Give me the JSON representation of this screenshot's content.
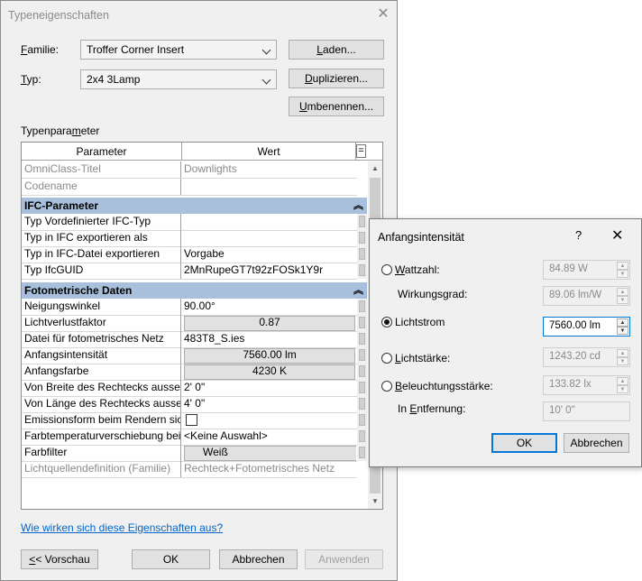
{
  "main_dialog": {
    "title": "Typeneigenschaften",
    "close": "✕",
    "familie_label": "Familie:",
    "familie_value": "Troffer Corner Insert",
    "typ_label": "Typ:",
    "typ_value": "2x4 3Lamp",
    "btn_laden": "Laden...",
    "btn_duplizieren": "Duplizieren...",
    "btn_umbenennen": "Umbenennen...",
    "typenparameter_label": "Typenparameter",
    "table_header": {
      "parameter": "Parameter",
      "wert": "Wert",
      "toggle": "="
    },
    "rows_top": [
      {
        "param": "OmniClass-Titel",
        "value": "Downlights"
      },
      {
        "param": "Codename",
        "value": ""
      }
    ],
    "group_ifc": "IFC-Parameter",
    "rows_ifc": [
      {
        "param": "Typ Vordefinierter IFC-Typ",
        "value": ""
      },
      {
        "param": "Typ in IFC exportieren als",
        "value": ""
      },
      {
        "param": "Typ in IFC-Datei exportieren",
        "value": "Vorgabe"
      },
      {
        "param": "Typ IfcGUID",
        "value": "2MnRupeGT7t92zFOSk1Y9r"
      }
    ],
    "group_foto": "Fotometrische Daten",
    "rows_foto": {
      "neigungswinkel": {
        "param": "Neigungswinkel",
        "value": "90.00°"
      },
      "lichtverlustfaktor": {
        "param": "Lichtverlustfaktor",
        "value": "0.87"
      },
      "datei": {
        "param": "Datei für fotometrisches Netz",
        "value": "483T8_S.ies"
      },
      "anfangsintensitaet": {
        "param": "Anfangsintensität",
        "value": "7560.00 lm"
      },
      "anfangsfarbe": {
        "param": "Anfangsfarbe",
        "value": "4230 K"
      },
      "breite": {
        "param": "Von Breite des Rechtecks ausse",
        "value": "2'  0\""
      },
      "laenge": {
        "param": "Von Länge des Rechtecks aussen",
        "value": "4'  0\""
      },
      "emission": {
        "param": "Emissionsform beim Rendern sic",
        "value": ""
      },
      "farbtemp": {
        "param": "Farbtemperaturverschiebung bei",
        "value": "<Keine Auswahl>"
      },
      "farbfilter": {
        "param": "Farbfilter",
        "value": "Weiß"
      },
      "lichtquelle": {
        "param": "Lichtquellendefinition (Familie)",
        "value": "Rechteck+Fotometrisches Netz"
      }
    },
    "help_link": "Wie wirken sich diese Eigenschaften aus?",
    "btn_vorschau": "<< Vorschau",
    "btn_ok": "OK",
    "btn_abbrechen": "Abbrechen",
    "btn_anwenden": "Anwenden"
  },
  "popup": {
    "title": "Anfangsintensität",
    "help": "?",
    "close": "✕",
    "wattzahl_label": "Wattzahl:",
    "wattzahl_value": "84.89 W",
    "wirkungsgrad_label": "Wirkungsgrad:",
    "wirkungsgrad_value": "89.06 lm/W",
    "lichtstrom_label": "Lichtstrom",
    "lichtstrom_value": "7560.00 lm",
    "lichtstaerke_label": "Lichtstärke:",
    "lichtstaerke_value": "1243.20 cd",
    "beleuchtung_label": "Beleuchtungsstärke:",
    "beleuchtung_value": "133.82 lx",
    "entfernung_label": "In Entfernung:",
    "entfernung_value": "10'  0\"",
    "btn_ok": "OK",
    "btn_abbrechen": "Abbrechen",
    "selected": "lichtstrom"
  },
  "colors": {
    "group_header": "#a8c0dc",
    "link": "#0066cc",
    "focus": "#0078d7"
  },
  "icons": [
    "close-icon",
    "chevron-down-icon",
    "collapse-icon",
    "help-icon",
    "spin-up-icon",
    "spin-down-icon"
  ]
}
